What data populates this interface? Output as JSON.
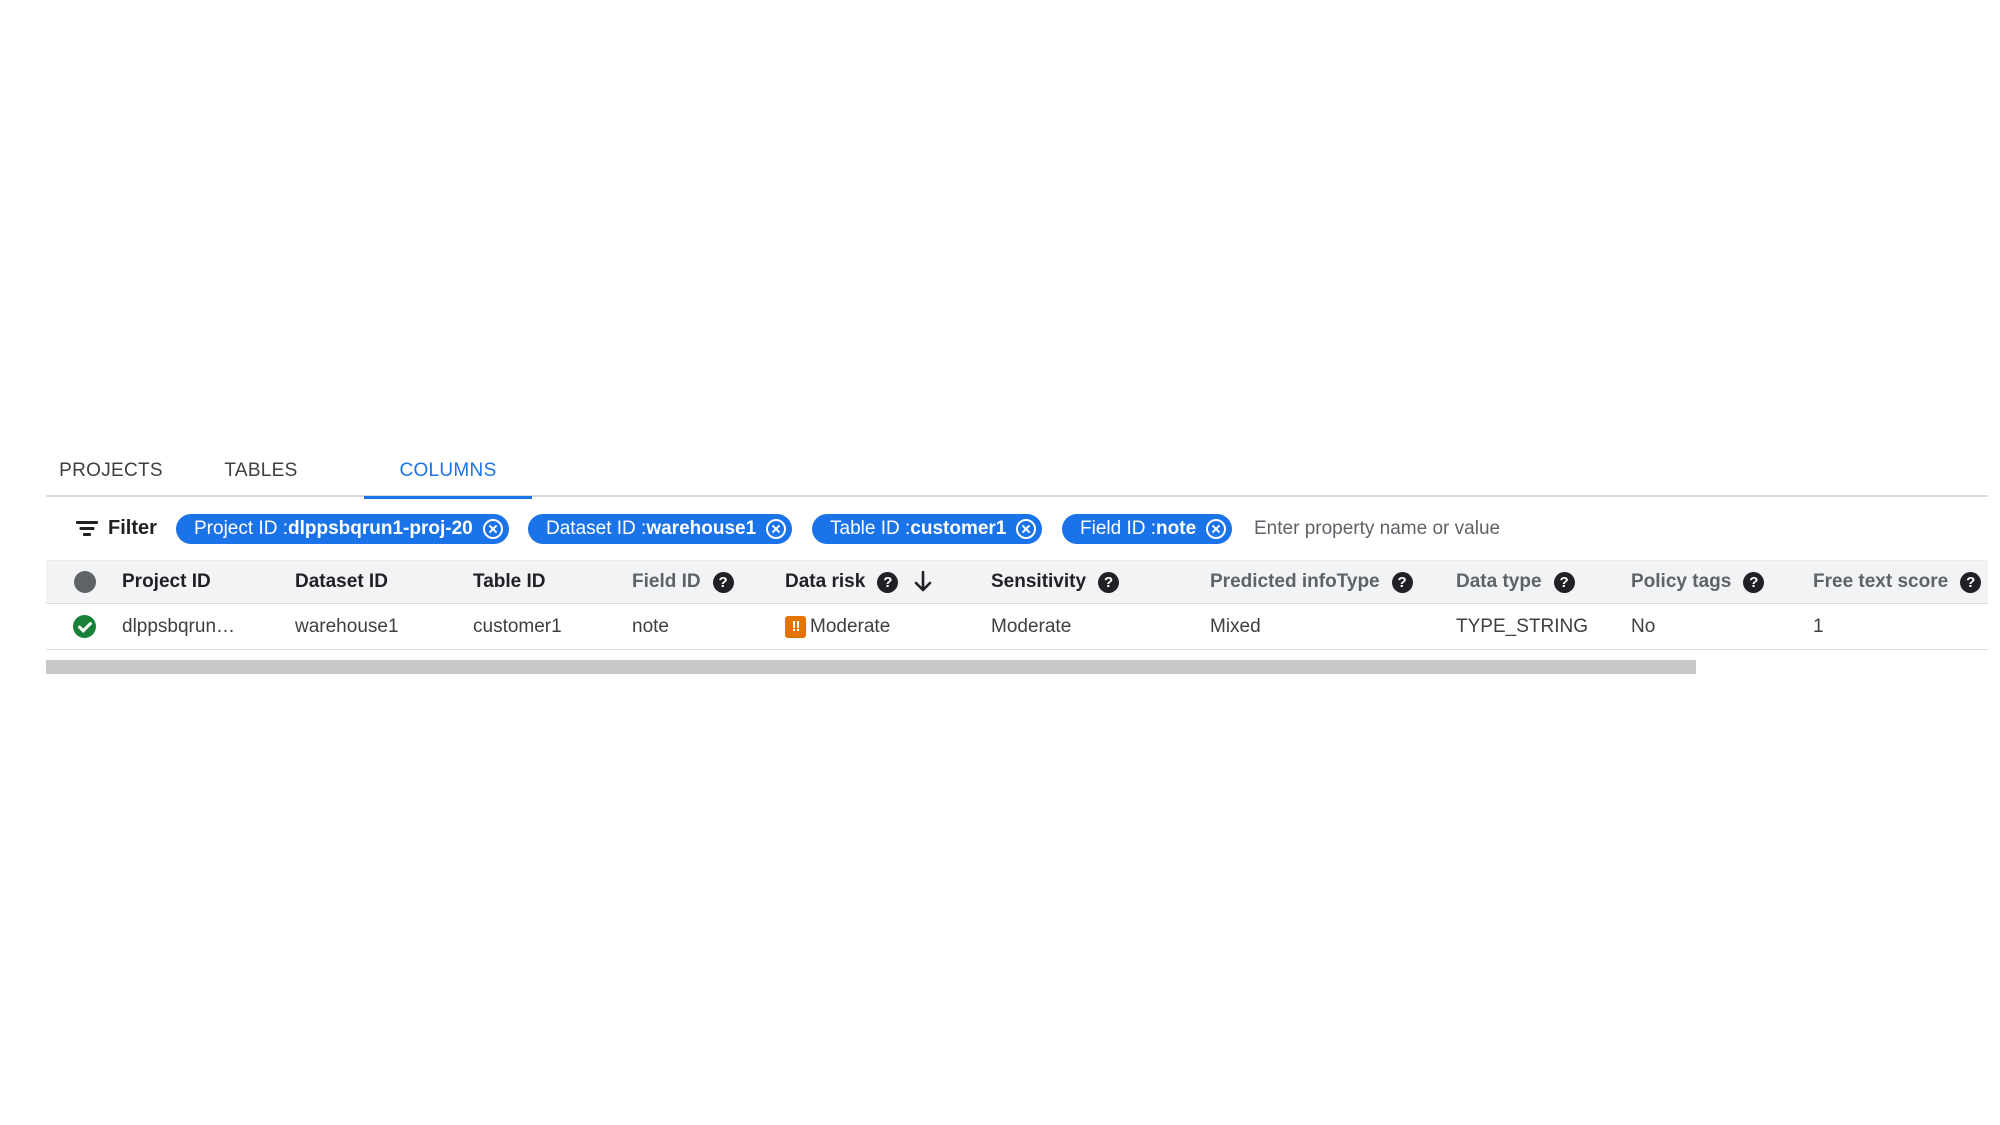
{
  "tabs": [
    {
      "label": "PROJECTS",
      "active": false
    },
    {
      "label": "TABLES",
      "active": false
    },
    {
      "label": "COLUMNS",
      "active": true
    }
  ],
  "filter": {
    "label": "Filter",
    "chips": [
      {
        "key": "Project ID : ",
        "value": "dlppsbqrun1-proj-20"
      },
      {
        "key": "Dataset ID : ",
        "value": "warehouse1"
      },
      {
        "key": "Table ID : ",
        "value": "customer1"
      },
      {
        "key": "Field ID : ",
        "value": "note"
      }
    ],
    "placeholder": "Enter property name or value"
  },
  "table": {
    "columns": [
      "Project ID",
      "Dataset ID",
      "Table ID",
      "Field ID",
      "Data risk",
      "Sensitivity",
      "Predicted infoType",
      "Data type",
      "Policy tags",
      "Free text score"
    ],
    "sorted_column": "Data risk",
    "sort_direction": "descending",
    "rows": [
      {
        "status": "success",
        "project_id": "dlppsbqrun…",
        "dataset_id": "warehouse1",
        "table_id": "customer1",
        "field_id": "note",
        "data_risk": "Moderate",
        "risk_badge": "!!",
        "sensitivity": "Moderate",
        "predicted_infotype": "Mixed",
        "data_type": "TYPE_STRING",
        "policy_tags": "No",
        "free_text_score": "1"
      }
    ]
  },
  "help_glyph": "?",
  "icons": {
    "filter": "filter-list-icon",
    "chip_remove": "cancel-circle-icon",
    "help": "help-circle-icon",
    "sort": "arrow-down-icon",
    "status": "check-circle-icon"
  },
  "colors": {
    "accent": "#1a73e8",
    "success": "#188038",
    "risk_moderate": "#e37400"
  }
}
